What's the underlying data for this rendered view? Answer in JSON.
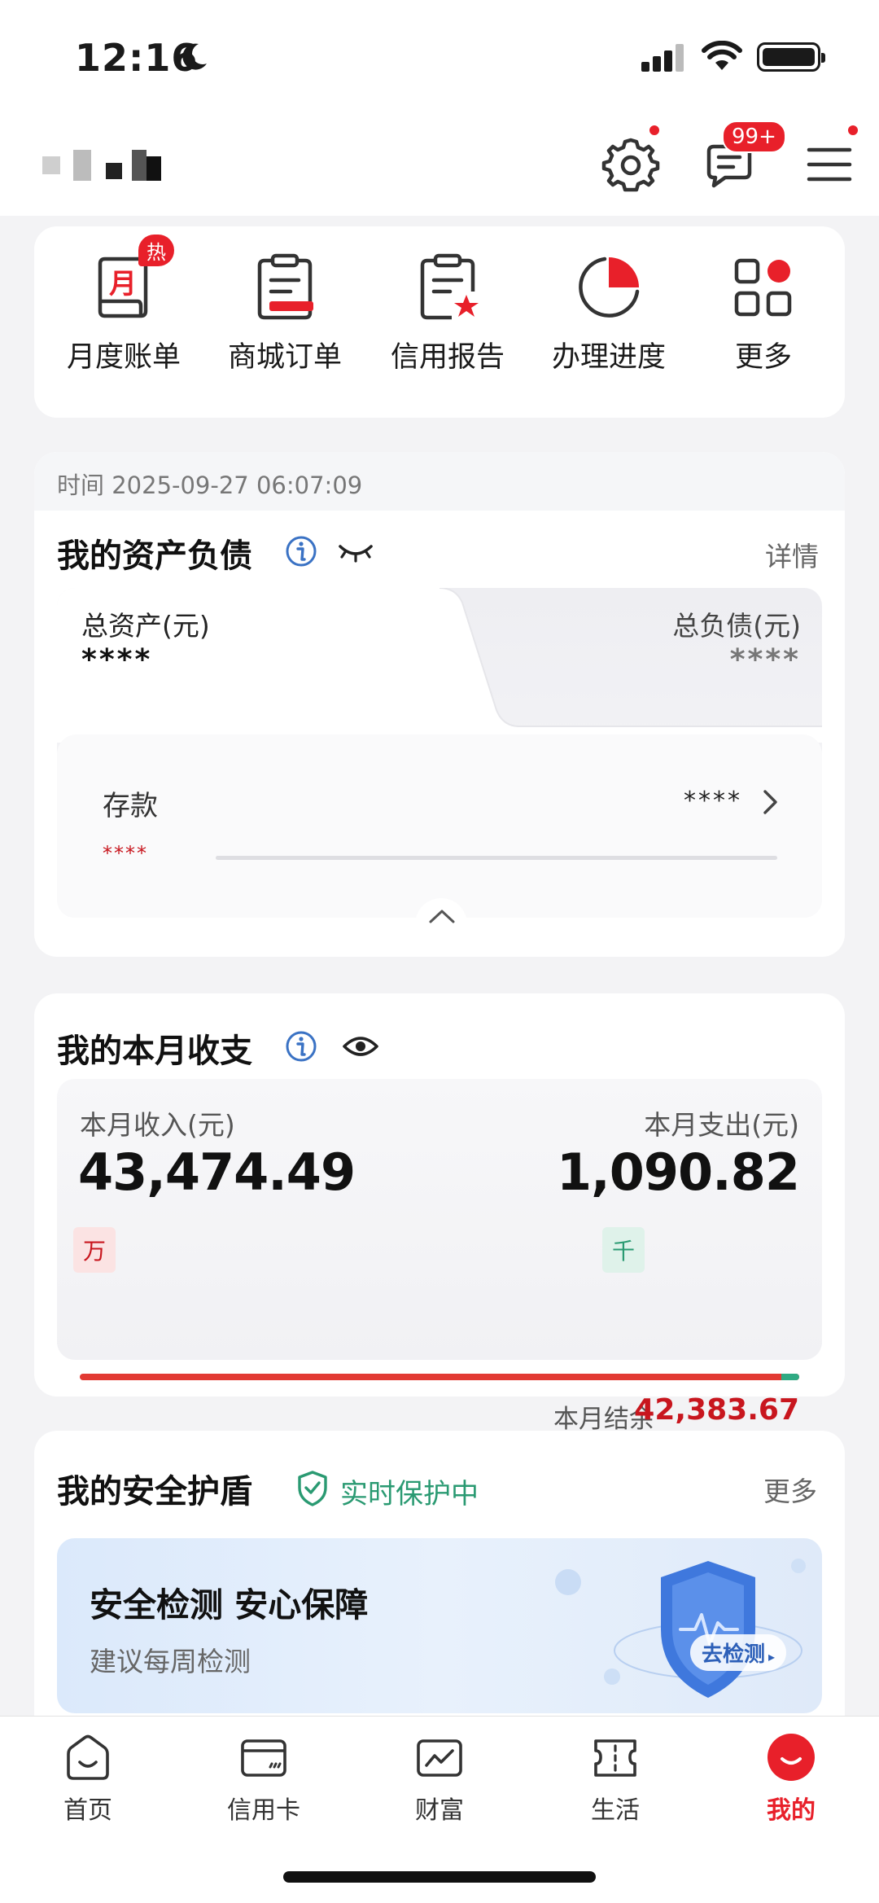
{
  "status": {
    "time": "12:16"
  },
  "header": {
    "message_badge": "99+"
  },
  "quick_actions": {
    "hot_badge": "热",
    "items": [
      {
        "label": "月度账单",
        "icon": "monthly-bill-icon"
      },
      {
        "label": "商城订单",
        "icon": "mall-order-icon"
      },
      {
        "label": "信用报告",
        "icon": "credit-report-icon"
      },
      {
        "label": "办理进度",
        "icon": "progress-icon"
      },
      {
        "label": "更多",
        "icon": "more-grid-icon"
      }
    ]
  },
  "assets": {
    "timestamp": "时间 2025-09-27 06:07:09",
    "title": "我的资产负债",
    "detail_link": "详情",
    "total_assets_label": "总资产(元)",
    "total_assets_value": "****",
    "total_liabilities_label": "总负债(元)",
    "total_liabilities_value": "****",
    "deposit_label": "存款",
    "deposit_value": "****",
    "deposit_sub_value": "****"
  },
  "income": {
    "title": "我的本月收支",
    "income_label": "本月收入(元)",
    "income_value": "43,474.49",
    "income_unit": "万",
    "expense_label": "本月支出(元)",
    "expense_value": "1,090.82",
    "expense_unit": "千",
    "balance_label": "本月结余",
    "balance_value": "42,383.67",
    "income_share": 0.975
  },
  "shield": {
    "title": "我的安全护盾",
    "status": "实时保护中",
    "more_link": "更多",
    "banner_title": "安全检测 安心保障",
    "banner_subtitle": "建议每周检测",
    "banner_button": "去检测"
  },
  "tabbar": {
    "items": [
      {
        "label": "首页",
        "icon": "home-icon"
      },
      {
        "label": "信用卡",
        "icon": "credit-card-icon"
      },
      {
        "label": "财富",
        "icon": "wealth-chart-icon"
      },
      {
        "label": "生活",
        "icon": "ticket-icon"
      },
      {
        "label": "我的",
        "icon": "profile-icon",
        "active": true
      }
    ]
  },
  "colors": {
    "accent": "#e8202a",
    "green": "#2a9a72",
    "info_blue": "#3a72c4"
  }
}
